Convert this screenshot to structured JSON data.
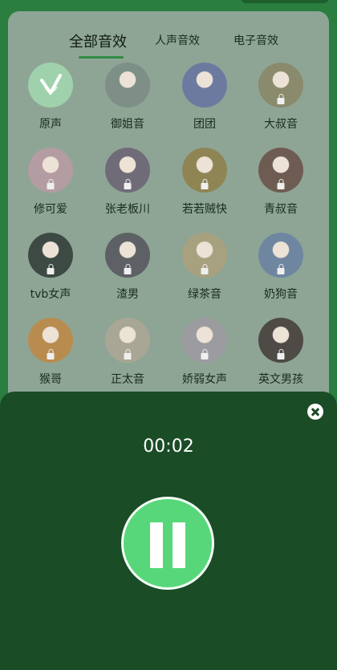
{
  "tabs": {
    "all": "全部音效",
    "human": "人声音效",
    "electronic": "电子音效"
  },
  "effects": [
    {
      "label": "原声",
      "icon": "voice-original-icon",
      "locked": false,
      "color": "#9fd1ad"
    },
    {
      "label": "御姐音",
      "icon": "avatar-mature-woman",
      "locked": false,
      "color": "#7d8f86"
    },
    {
      "label": "团团",
      "icon": "avatar-tuantuan",
      "locked": false,
      "color": "#6d7aa0"
    },
    {
      "label": "大叔音",
      "icon": "avatar-uncle",
      "locked": true,
      "color": "#8a8a6c"
    },
    {
      "label": "修可爱",
      "icon": "avatar-cute",
      "locked": true,
      "color": "#b39ca2"
    },
    {
      "label": "张老板川",
      "icon": "avatar-boss-zhang",
      "locked": true,
      "color": "#6f6b78"
    },
    {
      "label": "若若贼快",
      "icon": "avatar-ruoruo",
      "locked": true,
      "color": "#8f8554"
    },
    {
      "label": "青叔音",
      "icon": "avatar-young-uncle",
      "locked": true,
      "color": "#6e5c52"
    },
    {
      "label": "tvb女声",
      "icon": "avatar-tvb-woman",
      "locked": true,
      "color": "#3d4a44"
    },
    {
      "label": "渣男",
      "icon": "avatar-scumbag",
      "locked": true,
      "color": "#5d6064"
    },
    {
      "label": "绿茶音",
      "icon": "avatar-green-tea",
      "locked": true,
      "color": "#a7a180"
    },
    {
      "label": "奶狗音",
      "icon": "avatar-puppy",
      "locked": true,
      "color": "#6f86a0"
    },
    {
      "label": "猴哥",
      "icon": "avatar-monkey",
      "locked": true,
      "color": "#b88c4e"
    },
    {
      "label": "正太音",
      "icon": "avatar-shota",
      "locked": true,
      "color": "#a8a694"
    },
    {
      "label": "娇弱女声",
      "icon": "avatar-delicate-woman",
      "locked": true,
      "color": "#9c9ca0"
    },
    {
      "label": "英文男孩",
      "icon": "avatar-english-boy",
      "locked": true,
      "color": "#4e4a46"
    }
  ],
  "recorder": {
    "timer": "00:02"
  }
}
